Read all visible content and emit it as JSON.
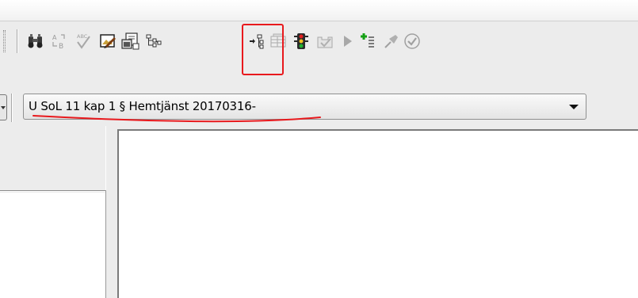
{
  "toolbar": {
    "buttons": [
      {
        "icon": "binoculars-icon",
        "enabled": true
      },
      {
        "icon": "replace-ab-icon",
        "enabled": false
      },
      {
        "icon": "spellcheck-icon",
        "enabled": false
      },
      {
        "icon": "image-edit-icon",
        "enabled": true
      },
      {
        "icon": "properties-icon",
        "enabled": true
      },
      {
        "icon": "tree-structure-icon",
        "enabled": true
      },
      {
        "icon": "insert-tree-node-icon",
        "enabled": true,
        "highlighted": true
      },
      {
        "icon": "table-icon",
        "enabled": false
      },
      {
        "icon": "traffic-light-icon",
        "enabled": true
      },
      {
        "icon": "inbox-check-icon",
        "enabled": false
      },
      {
        "icon": "play-icon",
        "enabled": false
      },
      {
        "icon": "add-list-item-icon",
        "enabled": true
      },
      {
        "icon": "pin-icon",
        "enabled": false
      },
      {
        "icon": "checkmark-circle-icon",
        "enabled": false
      }
    ]
  },
  "combo": {
    "selected_value": "U SoL 11 kap 1 § Hemtjänst 20170316-"
  },
  "colors": {
    "annotation": "#e8191d",
    "background": "#ececec",
    "pane": "#ffffff"
  }
}
